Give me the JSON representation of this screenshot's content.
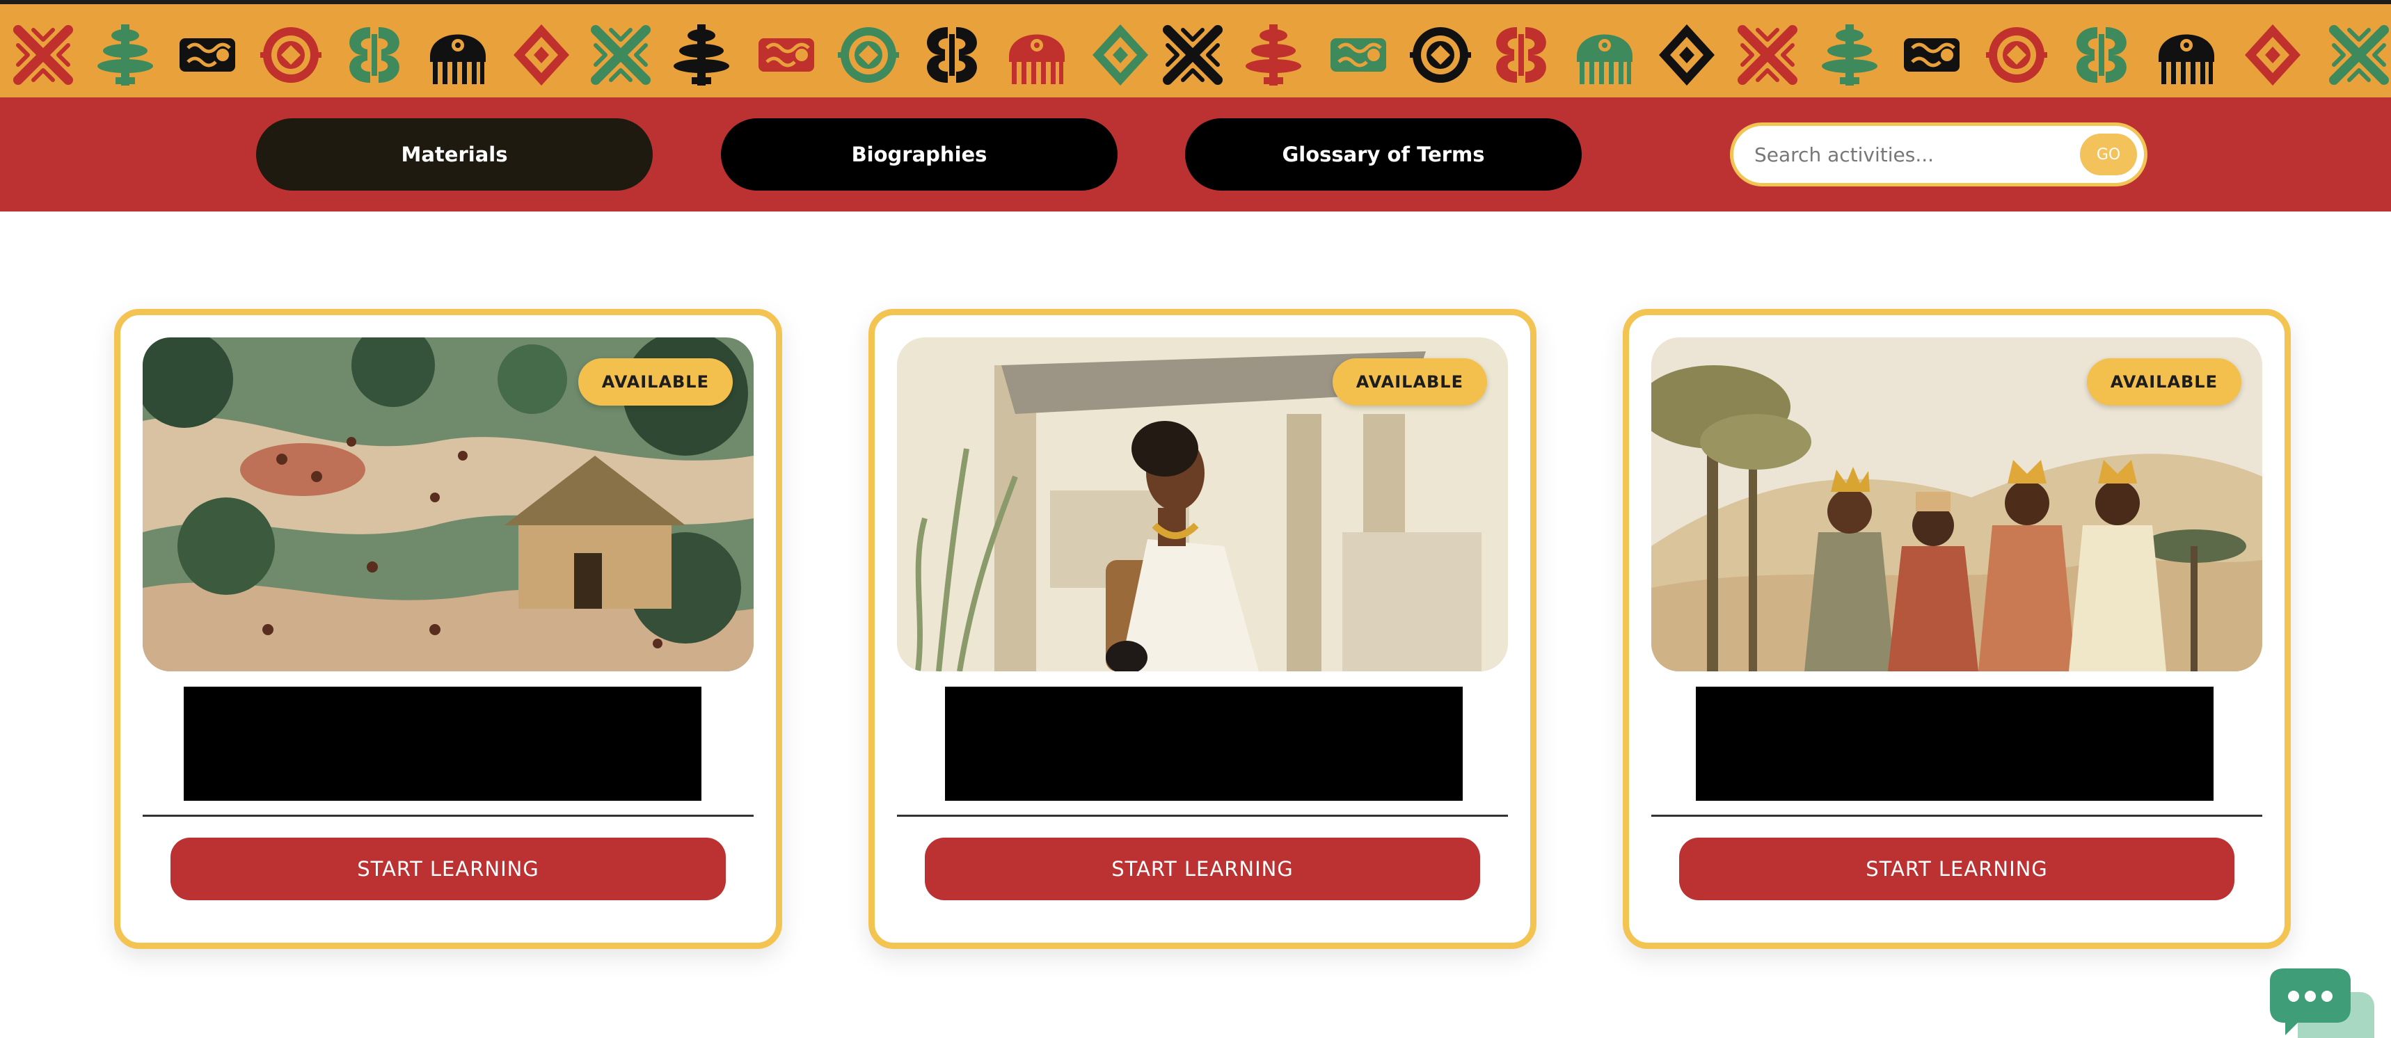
{
  "header": {
    "pattern_band": {
      "name": "Decorative Adinkra symbol band",
      "background": "#e9a23b",
      "motif_colors": [
        "#c0302d",
        "#3f8a5c",
        "#111111"
      ]
    }
  },
  "nav": {
    "background": "#bc3131",
    "items": [
      {
        "label": "Materials",
        "active": true
      },
      {
        "label": "Biographies",
        "active": false
      },
      {
        "label": "Glossary of Terms",
        "active": false
      }
    ],
    "search": {
      "placeholder": "Search activities...",
      "value": "",
      "button_label": "GO"
    }
  },
  "cards": [
    {
      "badge": "AVAILABLE",
      "image_icon": "village-illustration",
      "title": "",
      "button": "START LEARNING"
    },
    {
      "badge": "AVAILABLE",
      "image_icon": "queen-illustration",
      "title": "",
      "button": "START LEARNING"
    },
    {
      "badge": "AVAILABLE",
      "image_icon": "kings-illustration",
      "title": "",
      "button": "START LEARNING"
    }
  ],
  "colors": {
    "accent_red": "#bc3131",
    "accent_gold": "#f3c451",
    "chat_green": "#3f9e78"
  },
  "chat": {
    "icon": "chat-bubble-icon"
  }
}
